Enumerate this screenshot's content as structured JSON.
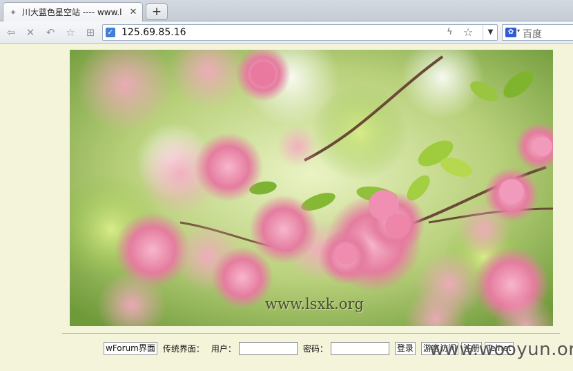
{
  "tab": {
    "title": "川大蓝色星空站 ---- www.l"
  },
  "address": {
    "url": "125.69.85.16"
  },
  "search": {
    "placeholder": "百度"
  },
  "hero": {
    "watermark": "www.lsxk.org"
  },
  "form": {
    "wforum_label": "wForum界面",
    "classic_label": "传统界面：",
    "user_label": "用户：",
    "password_label": "密码：",
    "login_label": "登录",
    "guest_label": "游客访问",
    "register_label": "注册",
    "telnet_label": "Telnet"
  },
  "overlay": {
    "watermark": "www.wooyun.org"
  },
  "icons": [
    "tab-favicon",
    "close-icon",
    "plus-icon",
    "back-icon",
    "stop-icon",
    "undo-icon",
    "star-icon",
    "grid-icon",
    "shield-icon",
    "bolt-icon",
    "chevron-down-icon",
    "baidu-icon"
  ],
  "colors": {
    "page_bg": "#f4f4da",
    "address_border": "#9fb0c4",
    "baidu_blue": "#2f5ad8"
  }
}
